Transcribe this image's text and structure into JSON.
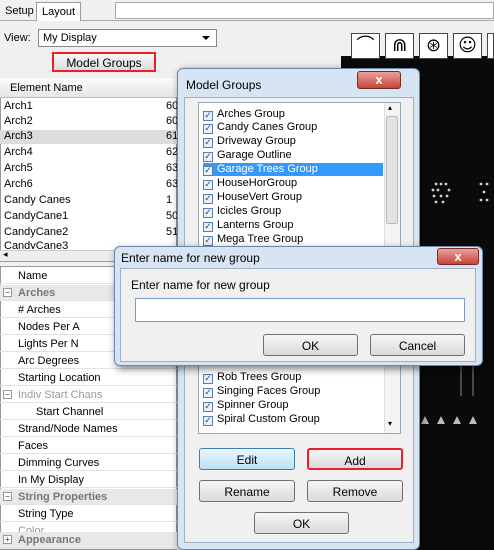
{
  "tabs": {
    "setup": "Setup",
    "layout": "Layout"
  },
  "view": {
    "label": "View:",
    "selected": "My Display"
  },
  "model_groups_button": "Model Groups",
  "element_list": {
    "header": "Element Name",
    "rows": [
      {
        "name": "Arch1",
        "value": "60"
      },
      {
        "name": "Arch2",
        "value": "60"
      },
      {
        "name": "Arch3",
        "value": "61"
      },
      {
        "name": "Arch4",
        "value": "62"
      },
      {
        "name": "Arch5",
        "value": "63"
      },
      {
        "name": "Arch6",
        "value": "63"
      },
      {
        "name": "Candy Canes",
        "value": "1"
      },
      {
        "name": "CandyCane1",
        "value": "50"
      },
      {
        "name": "CandyCane2",
        "value": "51"
      },
      {
        "name": "CandyCane3",
        "value": ""
      }
    ]
  },
  "property_grid": {
    "rows": [
      {
        "label": "Name",
        "kind": "plain"
      },
      {
        "label": "Arches",
        "kind": "category"
      },
      {
        "label": "# Arches",
        "kind": "plain"
      },
      {
        "label": "Nodes Per A",
        "kind": "plain"
      },
      {
        "label": "Lights Per N",
        "kind": "plain"
      },
      {
        "label": "Arc Degrees",
        "kind": "plain"
      },
      {
        "label": "Starting Location",
        "kind": "plain"
      },
      {
        "label": "Indiv Start Chans",
        "kind": "gray-cat"
      },
      {
        "label": "Start Channel",
        "kind": "indent"
      },
      {
        "label": "Strand/Node Names",
        "kind": "plain"
      },
      {
        "label": "Faces",
        "kind": "plain"
      },
      {
        "label": "Dimming Curves",
        "kind": "plain"
      },
      {
        "label": "In My Display",
        "kind": "plain"
      },
      {
        "label": "String Properties",
        "kind": "category"
      },
      {
        "label": "String Type",
        "kind": "plain"
      },
      {
        "label": "Color",
        "kind": "gray"
      },
      {
        "label": "Appearance",
        "kind": "category-plus"
      }
    ]
  },
  "model_groups_dialog": {
    "title": "Model Groups",
    "close": "x",
    "items_top": [
      "Arches Group",
      "Candy Canes Group",
      "Driveway Group",
      "Garage Outline",
      "Garage Trees Group",
      "HouseHorGroup",
      "HouseVert Group",
      "Icicles Group",
      "Lanterns Group",
      "Mega Tree Group"
    ],
    "selected_index": 4,
    "items_bottom": [
      "Rob Trees Group",
      "Singing Faces Group",
      "Spinner Group",
      "Spiral Custom Group"
    ],
    "buttons": {
      "edit": "Edit",
      "add": "Add",
      "rename": "Rename",
      "remove": "Remove",
      "ok": "OK"
    }
  },
  "enter_name_dialog": {
    "title": "Enter name for new group",
    "prompt": "Enter name for new group",
    "input_value": "",
    "close": "x",
    "ok": "OK",
    "cancel": "Cancel"
  },
  "toolbar_icons": [
    "arch-tool-icon",
    "multi-arch-tool-icon",
    "circle-tool-icon",
    "face-tool-icon"
  ]
}
